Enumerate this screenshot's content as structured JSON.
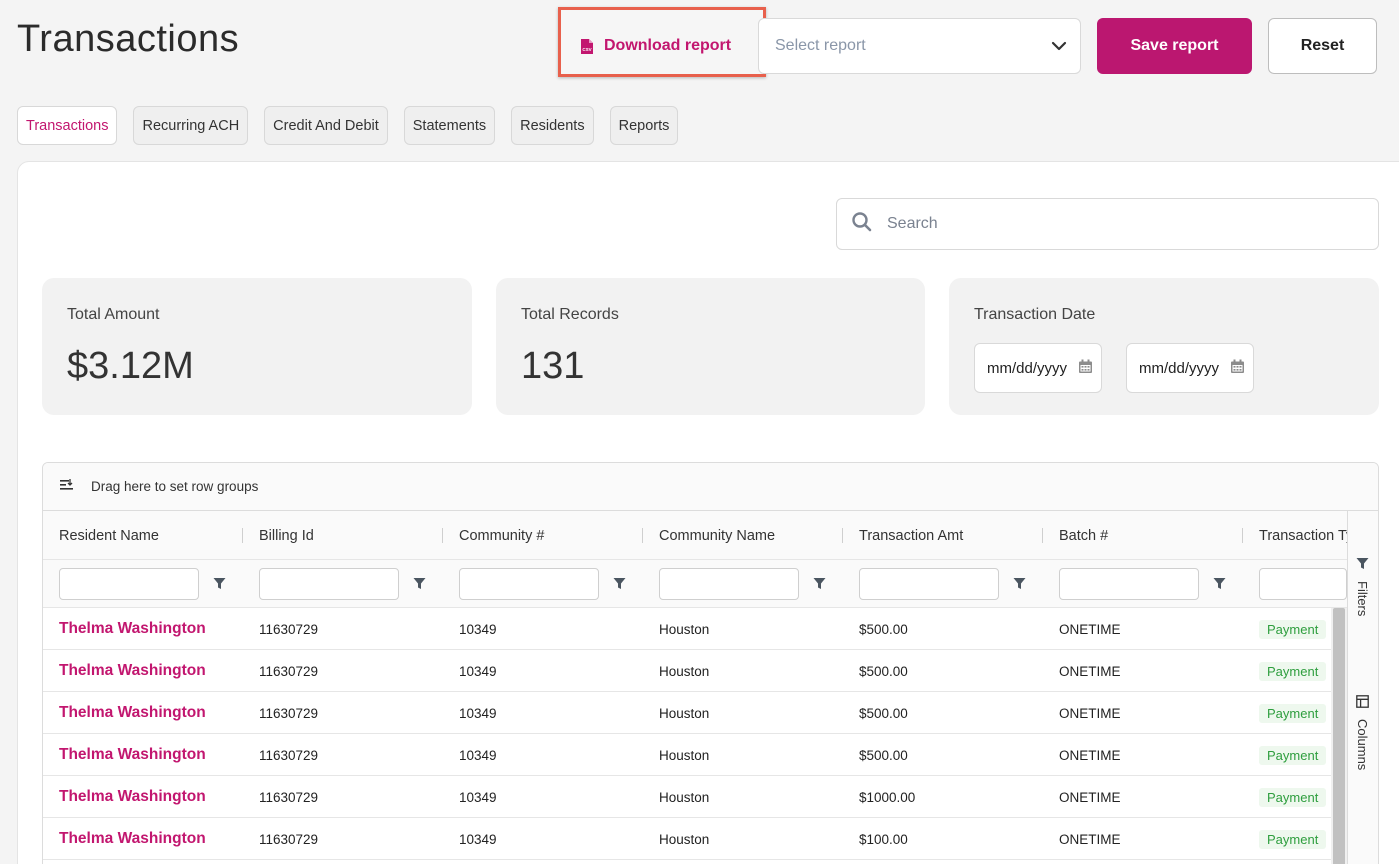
{
  "page": {
    "title": "Transactions"
  },
  "toolbar": {
    "download_label": "Download report",
    "select_placeholder": "Select report",
    "save_label": "Save report",
    "reset_label": "Reset"
  },
  "tabs": [
    {
      "label": "Transactions",
      "active": true
    },
    {
      "label": "Recurring ACH",
      "active": false
    },
    {
      "label": "Credit And Debit",
      "active": false
    },
    {
      "label": "Statements",
      "active": false
    },
    {
      "label": "Residents",
      "active": false
    },
    {
      "label": "Reports",
      "active": false
    }
  ],
  "search": {
    "placeholder": "Search"
  },
  "summary": {
    "total_amount": {
      "label": "Total Amount",
      "value": "$3.12M"
    },
    "total_records": {
      "label": "Total Records",
      "value": "131"
    },
    "transaction_date": {
      "label": "Transaction Date",
      "from_placeholder": "mm/dd/yyyy",
      "to_placeholder": "mm/dd/yyyy"
    }
  },
  "grid": {
    "group_bar_text": "Drag here to set row groups",
    "columns": [
      "Resident Name",
      "Billing Id",
      "Community #",
      "Community Name",
      "Transaction Amt",
      "Batch #",
      "Transaction Type"
    ],
    "rows": [
      [
        "Thelma Washington",
        "11630729",
        "10349",
        "Houston",
        "$500.00",
        "ONETIME",
        "Payment"
      ],
      [
        "Thelma Washington",
        "11630729",
        "10349",
        "Houston",
        "$500.00",
        "ONETIME",
        "Payment"
      ],
      [
        "Thelma Washington",
        "11630729",
        "10349",
        "Houston",
        "$500.00",
        "ONETIME",
        "Payment"
      ],
      [
        "Thelma Washington",
        "11630729",
        "10349",
        "Houston",
        "$500.00",
        "ONETIME",
        "Payment"
      ],
      [
        "Thelma Washington",
        "11630729",
        "10349",
        "Houston",
        "$1000.00",
        "ONETIME",
        "Payment"
      ],
      [
        "Thelma Washington",
        "11630729",
        "10349",
        "Houston",
        "$100.00",
        "ONETIME",
        "Payment"
      ]
    ],
    "side_panels": {
      "filters": "Filters",
      "columns": "Columns"
    }
  },
  "colors": {
    "accent": "#bb1770",
    "link": "#c2166f",
    "highlight": "#e8604c",
    "badge_text": "#2e9e3e"
  }
}
